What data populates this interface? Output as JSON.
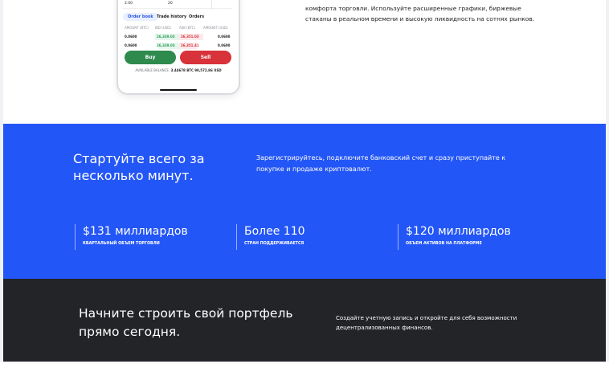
{
  "phone": {
    "top_row": {
      "left": "2.00",
      "right": "20"
    },
    "tabs": [
      "Order book",
      "Trade history",
      "Orders"
    ],
    "columns": [
      "AMOUNT (BTC)",
      "BID (USD)",
      "ASK (BTC)",
      "AMOUNT (USD)"
    ],
    "rows": [
      {
        "amount_btc": "0.0600",
        "bid": "26,339.03",
        "ask": "26,351.03",
        "amount_usd": "0.0600"
      },
      {
        "amount_btc": "0.0600",
        "bid": "26,339.03",
        "ask": "26,351.41",
        "amount_usd": "0.0600"
      }
    ],
    "buy_label": "Buy",
    "sell_label": "Sell",
    "balance_label": "AVAILABLE BALANCE:",
    "balance_btc": "3.44678 BTC",
    "balance_usd": "90,572.86 USD"
  },
  "intro_text": "комфорта торговли. Используйте расширенные графики, биржевые стаканы в реальном времени и высокую ликвидность на сотнях рынков.",
  "blue_section": {
    "title": "Стартуйте всего за несколько минут.",
    "description": "Зарегистрируйтесь, подключите банковский счет и сразу приступайте к покупке и продаже криптовалют.",
    "stats": [
      {
        "value": "$131 миллиардов",
        "label": "КВАРТАЛЬНЫЙ ОБЪЕМ ТОРГОВЛИ"
      },
      {
        "value": "Более 110",
        "label": "СТРАН ПОДДЕРЖИВАЕТСЯ"
      },
      {
        "value": "$120 миллиардов",
        "label": "ОБЪЕМ АКТИВОВ НА ПЛАТФОРМЕ"
      }
    ]
  },
  "dark_section": {
    "title": "Начните строить свой портфель прямо сегодня.",
    "description": "Создайте учетную запись и откройте для себя возможности децентрализованных финансов."
  },
  "colors": {
    "blue_bg": "#2356f6",
    "dark_bg": "#232428",
    "buy": "#2e8a4d",
    "sell": "#d8323a",
    "bid_text": "#2e9e5b",
    "ask_text": "#d8323a"
  }
}
